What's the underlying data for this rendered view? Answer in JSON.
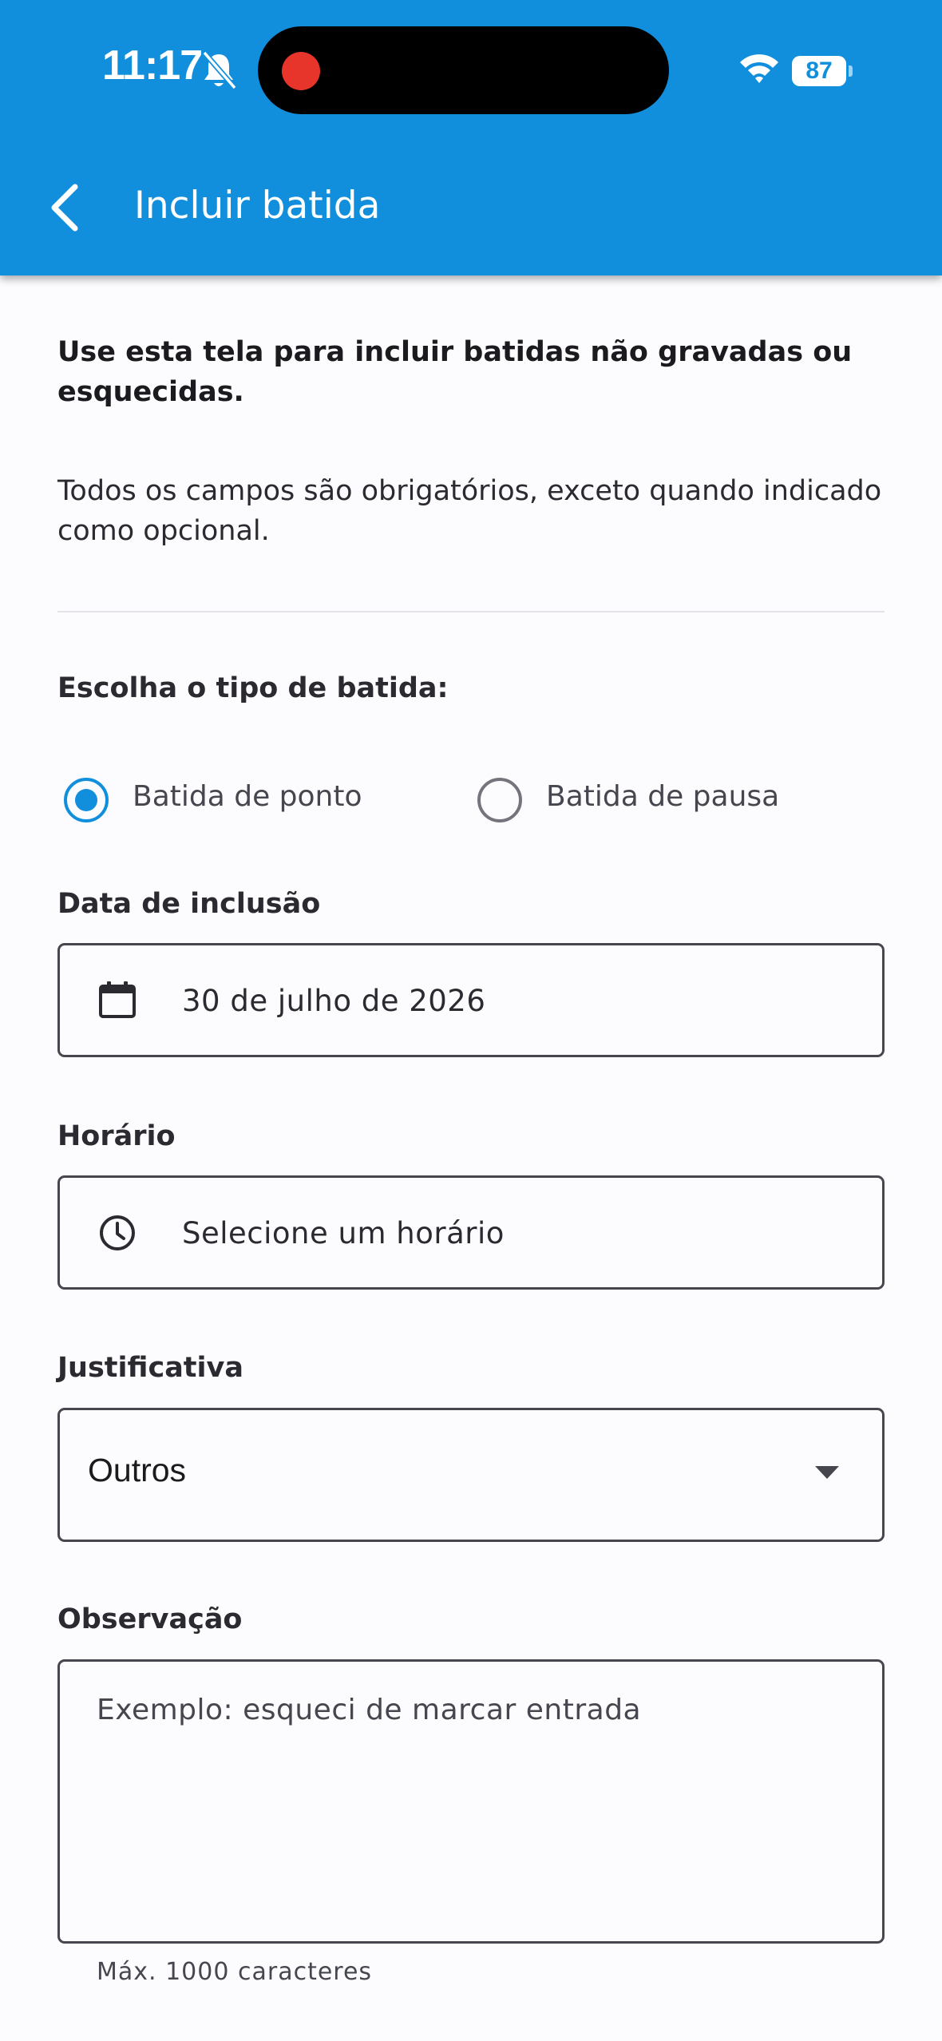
{
  "status_bar": {
    "time": "11:17",
    "battery_level": 87,
    "icons": [
      "bell-off-icon",
      "wifi-icon",
      "battery-icon"
    ]
  },
  "header": {
    "title": "Incluir batida",
    "back_icon": "chevron-left-icon"
  },
  "intro": {
    "instruction": "Use esta tela para incluir batidas não gravadas ou esquecidas.",
    "required_note": "Todos os campos são obrigatórios, exceto quando indicado como opcional."
  },
  "punch_type": {
    "label": "Escolha o tipo de batida:",
    "options": [
      {
        "label": "Batida de ponto",
        "selected": true
      },
      {
        "label": "Batida de pausa",
        "selected": false
      }
    ]
  },
  "date_field": {
    "label": "Data de inclusão",
    "value": "30 de julho de 2026",
    "icon": "calendar-icon"
  },
  "time_field": {
    "label": "Horário",
    "placeholder": "Selecione um horário",
    "icon": "clock-icon"
  },
  "justification": {
    "label": "Justificativa",
    "selected": "Outros",
    "icon": "dropdown-arrow-icon"
  },
  "observation": {
    "label": "Observação",
    "placeholder": "Exemplo: esqueci de marcar entrada",
    "helper": "Máx. 1000 caracteres"
  },
  "colors": {
    "primary": "#118fdc",
    "background": "#fcfcff",
    "outline": "#46464f",
    "recording": "#e8352c"
  }
}
